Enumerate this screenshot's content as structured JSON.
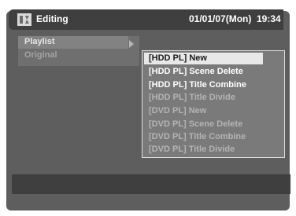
{
  "header": {
    "icon": "editing-icon",
    "title": "Editing",
    "date": "01/01/07(Mon)",
    "time": "19:34"
  },
  "left_menu": {
    "items": [
      {
        "label": "Playlist",
        "state": "active"
      },
      {
        "label": "Original",
        "state": "inactive"
      }
    ]
  },
  "submenu": {
    "items": [
      {
        "label": "[HDD PL] New",
        "state": "selected"
      },
      {
        "label": "[HDD PL] Scene Delete",
        "state": "enabled"
      },
      {
        "label": "[HDD PL] Title Combine",
        "state": "enabled"
      },
      {
        "label": "[HDD PL] Title Divide",
        "state": "disabled"
      },
      {
        "label": "[DVD PL] New",
        "state": "disabled"
      },
      {
        "label": "[DVD PL] Scene Delete",
        "state": "disabled"
      },
      {
        "label": "[DVD PL] Title Combine",
        "state": "disabled"
      },
      {
        "label": "[DVD PL] Title Divide",
        "state": "disabled"
      }
    ]
  }
}
